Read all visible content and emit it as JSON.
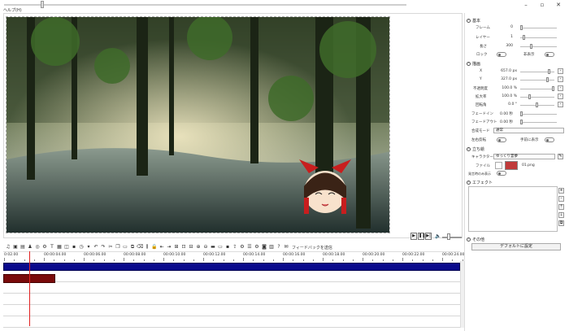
{
  "menu": {
    "help": "ヘルプ(H)"
  },
  "window_controls": {
    "minimize": "–",
    "maximize": "▫",
    "close": "✕"
  },
  "playback": {
    "play": "▶",
    "pause": "❚❚",
    "next": "▶|"
  },
  "toolbar": {
    "feedback_label": "フィードバックを送信"
  },
  "ruler": {
    "labels": [
      "0:02.00",
      "00:00:04.00",
      "00:00:06.00",
      "00:00:08.00",
      "00:00:10.00",
      "00:00:12.00",
      "00:00:14.00",
      "00:00:16.00",
      "00:00:18.00",
      "00:00:20.00",
      "00:00:22.00",
      "00:00:24.00"
    ]
  },
  "panel": {
    "basic": {
      "title": "基本",
      "frame_label": "フレーム",
      "frame_value": "0",
      "layer_label": "レイヤー",
      "layer_value": "1",
      "length_label": "長さ",
      "length_value": "300",
      "lock_label": "ロック",
      "hide_label": "非表示"
    },
    "draw": {
      "title": "描画",
      "x_label": "X",
      "x_value": "657.0 px",
      "y_label": "Y",
      "y_value": "327.0 px",
      "opacity_label": "不透明度",
      "opacity_value": "100.0 %",
      "zoom_label": "拡大率",
      "zoom_value": "100.0 %",
      "rotation_label": "回転角",
      "rotation_value": "0.0 °",
      "fadein_label": "フェードイン",
      "fadein_value": "0.00 秒",
      "fadeout_label": "フェードアウト",
      "fadeout_value": "0.00 秒",
      "blend_label": "合成モード",
      "blend_value": "通常",
      "flip_label": "左右反転",
      "always_front_label": "手前に表示"
    },
    "character": {
      "title": "立ち絵",
      "character_label": "キャラクター",
      "character_value": "ゆっくり霊夢",
      "file_label": "ファイル",
      "file_value": "01.png",
      "only_speaking_label": "発言時のみ表示"
    },
    "effect": {
      "title": "エフェクト"
    },
    "other": {
      "title": "その他",
      "default_button": "デフォルトに設定"
    }
  },
  "colors": {
    "video_clip": "#0a0a8c",
    "character_clip": "#7a0a0a",
    "playhead": "#e02020"
  }
}
